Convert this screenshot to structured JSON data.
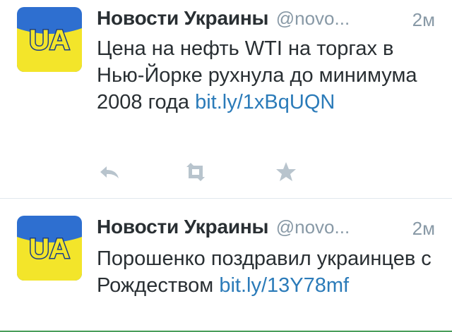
{
  "tweets": [
    {
      "name": "Новости Украины",
      "handle": "@novo...",
      "time": "2м",
      "avatar_text": "UA",
      "text_before_link": "Цена на нефть WTI на торгах в Нью-Йорке рухнула до минимума 2008 года ",
      "link": "bit.ly/1xBqUQN",
      "actions": [
        "reply-icon",
        "retweet-icon",
        "favorite-icon"
      ]
    },
    {
      "name": "Новости Украины",
      "handle": "@novo...",
      "time": "2м",
      "avatar_text": "UA",
      "text_before_link": "Порошенко поздравил украинцев с Рождеством ",
      "link": "bit.ly/13Y78mf"
    }
  ],
  "colors": {
    "avatar_blue": "#2e6fd0",
    "avatar_yellow": "#f3e52a",
    "link": "#2b7bb9",
    "meta_gray": "#8899a6",
    "text": "#292f33"
  }
}
